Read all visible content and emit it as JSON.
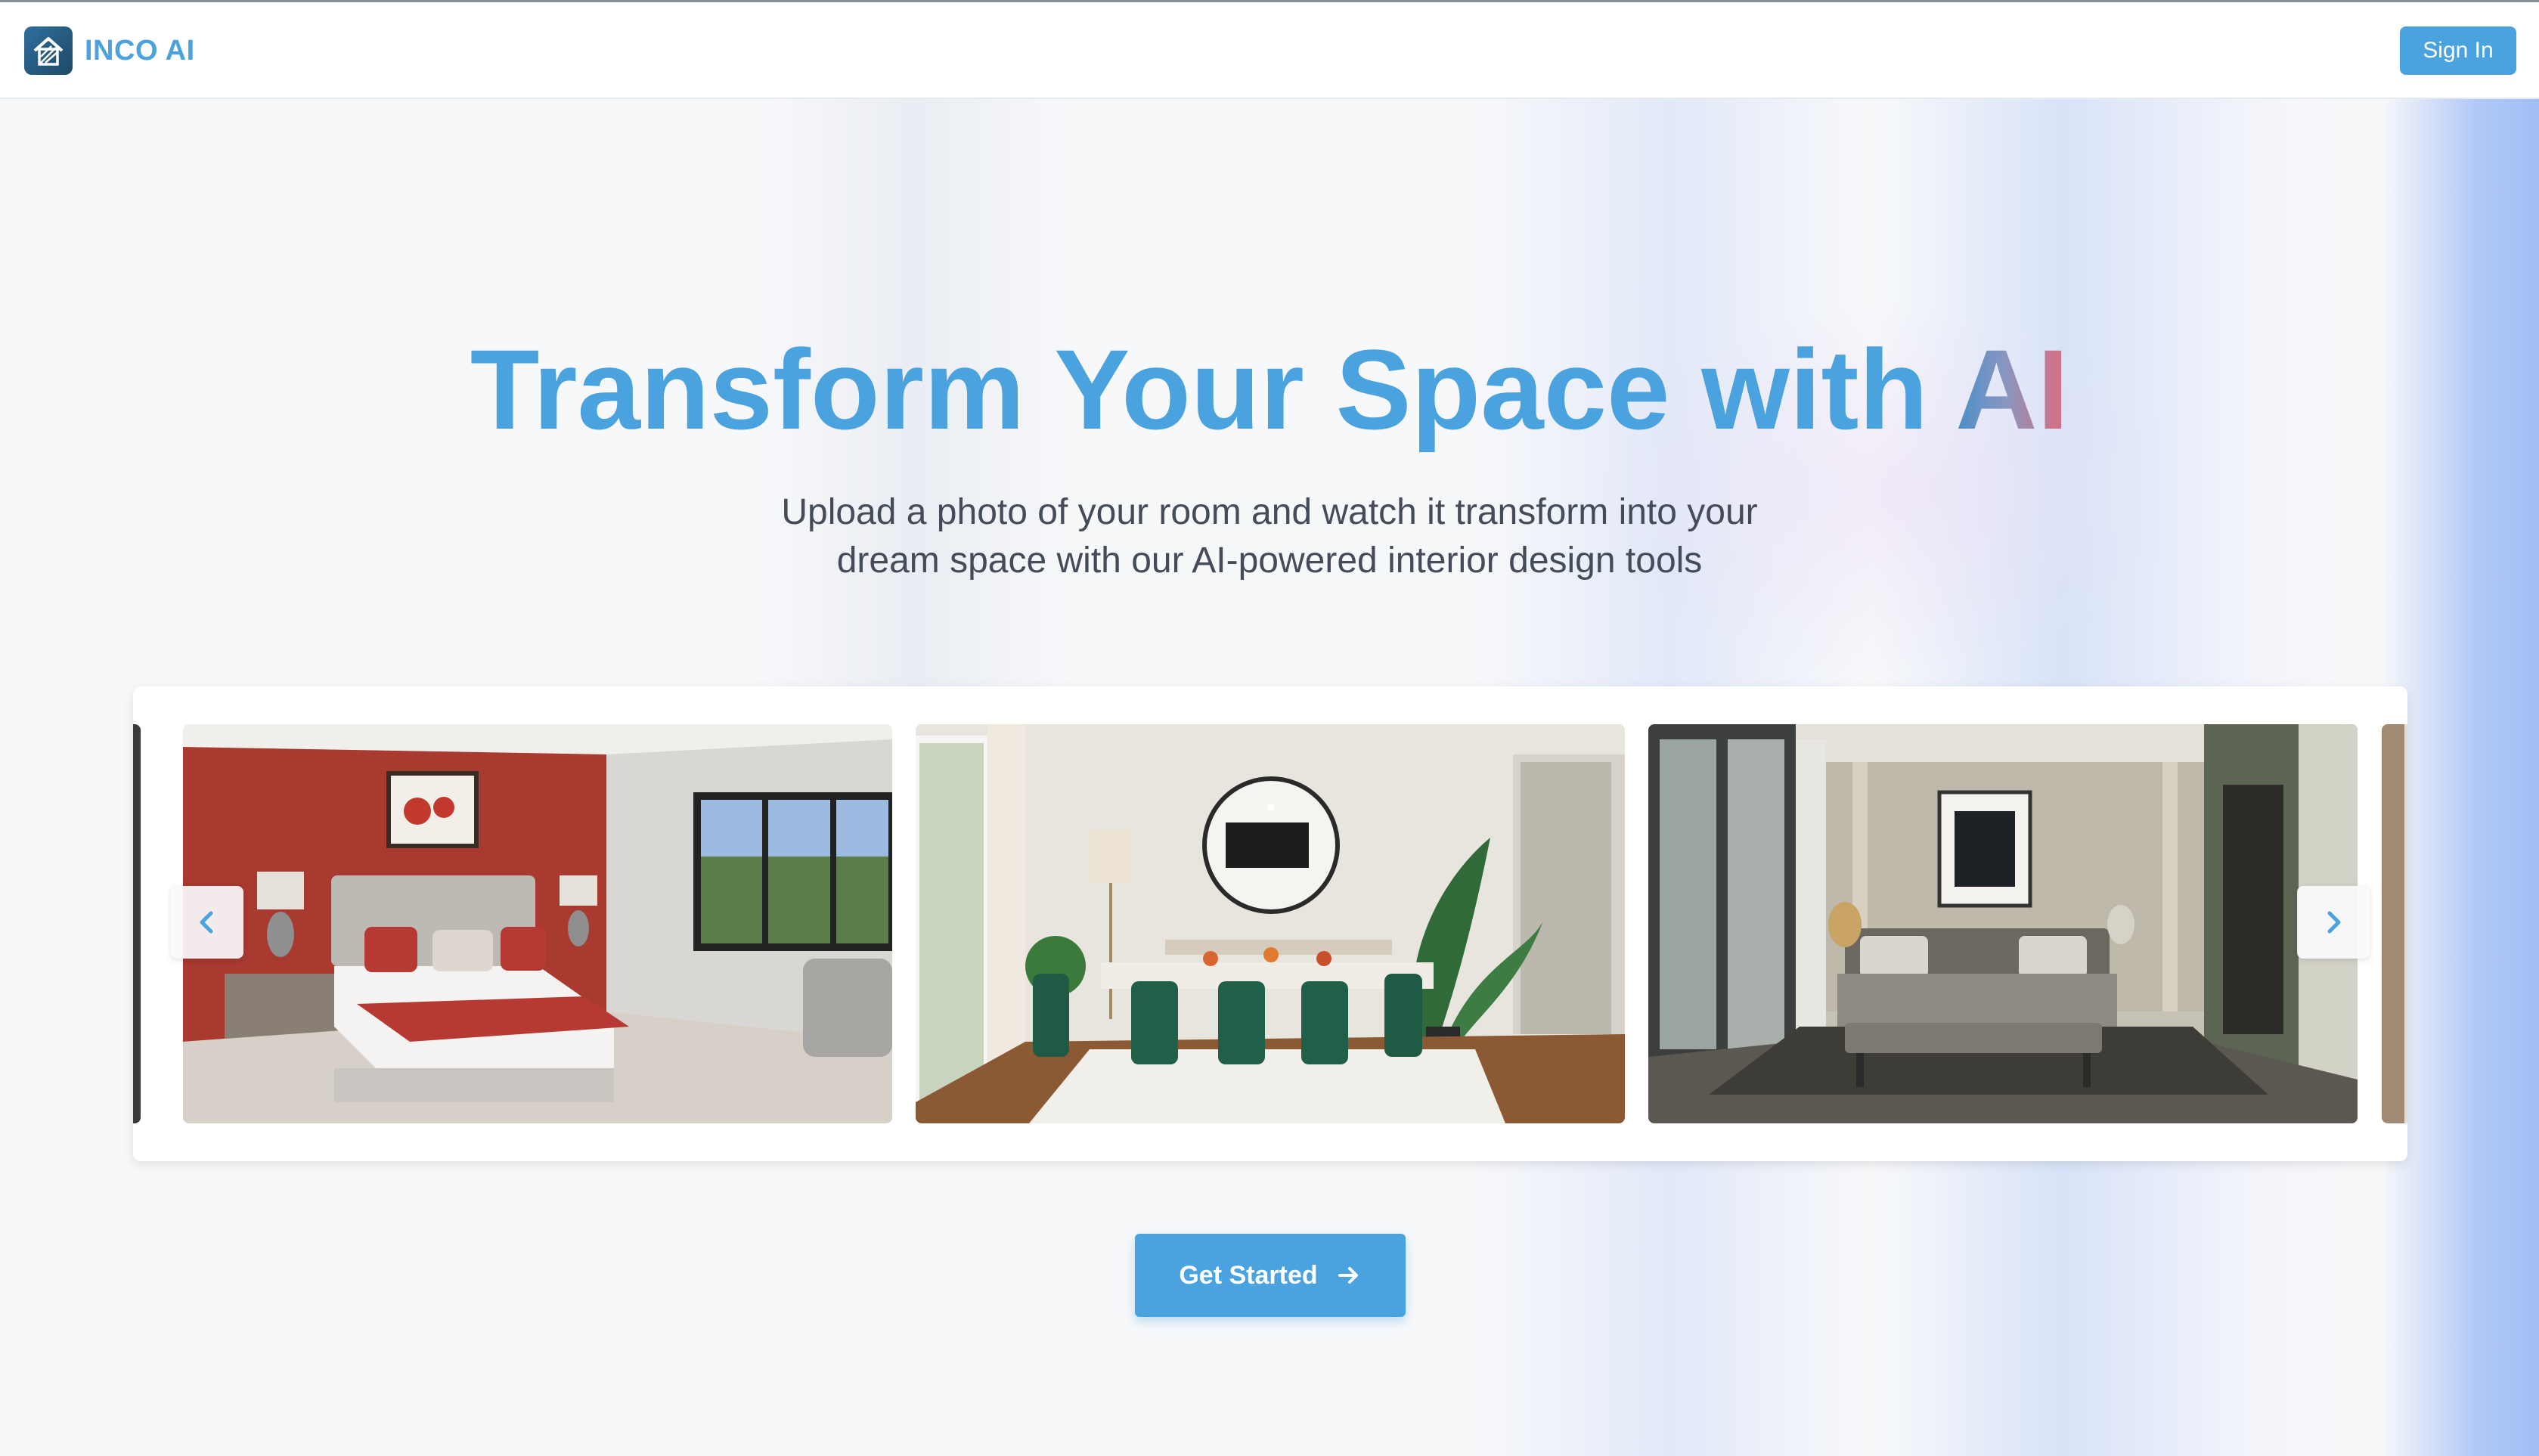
{
  "nav": {
    "brand_name": "INCO AI",
    "sign_in_label": "Sign In"
  },
  "hero": {
    "title_main": "Transform Your Space with ",
    "title_highlight": "AI",
    "subtitle_line1": "Upload a photo of your room and watch it transform into your",
    "subtitle_line2": "dream space with our AI-powered interior design tools"
  },
  "carousel": {
    "slides": [
      {
        "room": "bedroom-red-accent-wall"
      },
      {
        "room": "dining-room-green-chairs"
      },
      {
        "room": "modern-bedroom-dark-tones"
      }
    ],
    "prev_icon": "chevron-left-icon",
    "next_icon": "chevron-right-icon"
  },
  "cta": {
    "label": "Get Started",
    "icon": "arrow-right-icon"
  },
  "colors": {
    "accent": "#4aa2de",
    "background": "#f7f8fa",
    "title_gradient_end": "#e06a7a"
  }
}
